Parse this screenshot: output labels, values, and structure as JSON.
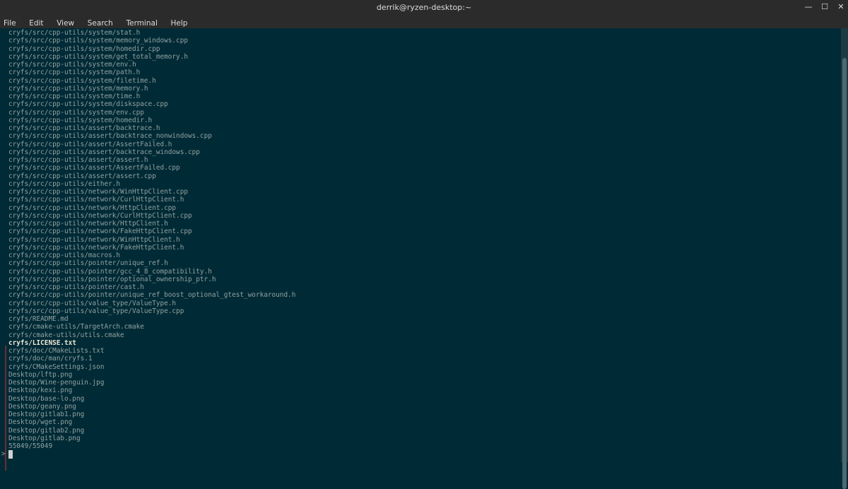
{
  "window": {
    "title": "derrik@ryzen-desktop:~",
    "minimize_glyph": "—",
    "maximize_glyph": "☐",
    "close_glyph": "✕"
  },
  "menu": [
    "File",
    "Edit",
    "View",
    "Search",
    "Terminal",
    "Help"
  ],
  "terminal": {
    "lines": [
      "cryfs/src/cpp-utils/system/stat.h",
      "cryfs/src/cpp-utils/system/memory_windows.cpp",
      "cryfs/src/cpp-utils/system/homedir.cpp",
      "cryfs/src/cpp-utils/system/get_total_memory.h",
      "cryfs/src/cpp-utils/system/env.h",
      "cryfs/src/cpp-utils/system/path.h",
      "cryfs/src/cpp-utils/system/filetime.h",
      "cryfs/src/cpp-utils/system/memory.h",
      "cryfs/src/cpp-utils/system/time.h",
      "cryfs/src/cpp-utils/system/diskspace.cpp",
      "cryfs/src/cpp-utils/system/env.cpp",
      "cryfs/src/cpp-utils/system/homedir.h",
      "cryfs/src/cpp-utils/assert/backtrace.h",
      "cryfs/src/cpp-utils/assert/backtrace_nonwindows.cpp",
      "cryfs/src/cpp-utils/assert/AssertFailed.h",
      "cryfs/src/cpp-utils/assert/backtrace_windows.cpp",
      "cryfs/src/cpp-utils/assert/assert.h",
      "cryfs/src/cpp-utils/assert/AssertFailed.cpp",
      "cryfs/src/cpp-utils/assert/assert.cpp",
      "cryfs/src/cpp-utils/either.h",
      "cryfs/src/cpp-utils/network/WinHttpClient.cpp",
      "cryfs/src/cpp-utils/network/CurlHttpClient.h",
      "cryfs/src/cpp-utils/network/HttpClient.cpp",
      "cryfs/src/cpp-utils/network/CurlHttpClient.cpp",
      "cryfs/src/cpp-utils/network/HttpClient.h",
      "cryfs/src/cpp-utils/network/FakeHttpClient.cpp",
      "cryfs/src/cpp-utils/network/WinHttpClient.h",
      "cryfs/src/cpp-utils/network/FakeHttpClient.h",
      "cryfs/src/cpp-utils/macros.h",
      "cryfs/src/cpp-utils/pointer/unique_ref.h",
      "cryfs/src/cpp-utils/pointer/gcc_4_8_compatibility.h",
      "cryfs/src/cpp-utils/pointer/optional_ownership_ptr.h",
      "cryfs/src/cpp-utils/pointer/cast.h",
      "cryfs/src/cpp-utils/pointer/unique_ref_boost_optional_gtest_workaround.h",
      "cryfs/src/cpp-utils/value_type/ValueType.h",
      "cryfs/src/cpp-utils/value_type/ValueType.cpp",
      "cryfs/README.md",
      "cryfs/cmake-utils/TargetArch.cmake",
      "cryfs/cmake-utils/utils.cmake",
      "cryfs/LICENSE.txt",
      "cryfs/doc/CMakeLists.txt",
      "cryfs/doc/man/cryfs.1",
      "cryfs/CMakeSettings.json",
      "Desktop/lftp.png",
      "Desktop/Wine-penguin.jpg",
      "Desktop/kexi.png",
      "Desktop/base-lo.png",
      "Desktop/geany.png",
      "Desktop/gitlab1.png",
      "Desktop/wget.png",
      "Desktop/gitlab2.png",
      "Desktop/gitlab.png"
    ],
    "selected_line": "cryfs/LICENSE.txt",
    "match_count": "55049/55049",
    "prompt": ">"
  },
  "colors": {
    "background": "#002b36",
    "text": "#93a1a1",
    "selected_text": "#eee8d5",
    "selection_marker": "#dc322f"
  }
}
